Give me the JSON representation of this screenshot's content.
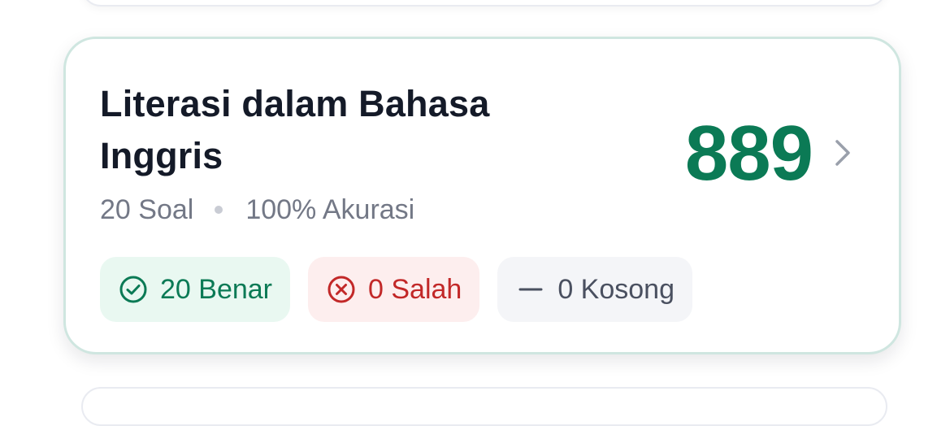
{
  "card": {
    "title": "Literasi dalam Bahasa Inggris",
    "questions_label": "20 Soal",
    "accuracy_label": "100% Akurasi",
    "score": "889"
  },
  "badges": {
    "correct": "20 Benar",
    "wrong": "0 Salah",
    "empty": "0 Kosong"
  },
  "icons": {
    "correct": "check-circle-icon",
    "wrong": "x-circle-icon",
    "empty": "dash-icon",
    "open": "chevron-right-icon"
  },
  "colors": {
    "score": "#0b7a55",
    "correct_bg": "#e9f8f1",
    "correct_text": "#0b7a55",
    "wrong_bg": "#fdeeee",
    "wrong_text": "#c22828",
    "empty_bg": "#f4f5f8",
    "empty_text": "#4a5060",
    "card_border": "#cfe6e0"
  }
}
